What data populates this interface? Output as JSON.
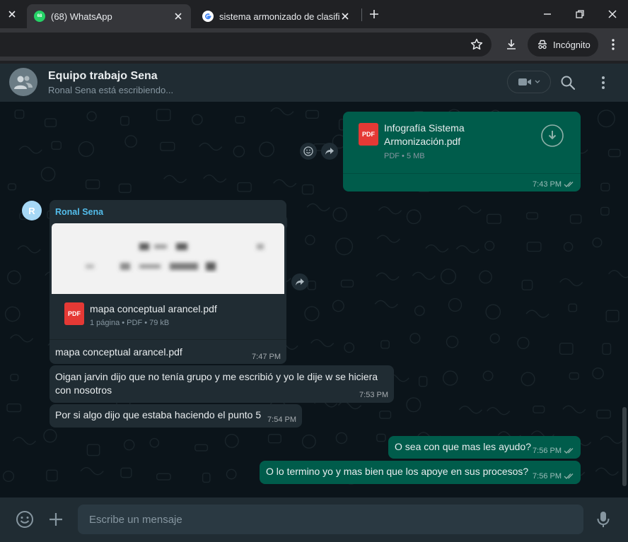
{
  "browser": {
    "tabs": [
      {
        "title": "(68) WhatsApp",
        "badge": "68",
        "active": true
      },
      {
        "title": "sistema armonizado de clasificaci",
        "active": false
      }
    ],
    "incognito_label": "Incógnito"
  },
  "chat": {
    "name": "Equipo trabajo Sena",
    "status": "Ronal Sena está escribiendo..."
  },
  "messages": {
    "m1": {
      "file_name": "Infografía Sistema Armonización.pdf",
      "file_info": "PDF • 5 MB",
      "pdf_label": "PDF",
      "time": "7:43 PM"
    },
    "m2": {
      "avatar_initial": "R",
      "sender": "Ronal Sena",
      "file_name": "mapa conceptual arancel.pdf",
      "file_info": "1 página • PDF • 79 kB",
      "pdf_label": "PDF",
      "caption": "mapa conceptual arancel.pdf",
      "time": "7:47 PM"
    },
    "m3": {
      "text": "Oigan jarvin dijo que no tenía grupo y me escribió y yo le dije w se hiciera con nosotros",
      "time": "7:53 PM"
    },
    "m4": {
      "text": "Por si algo dijo que estaba haciendo el punto 5",
      "time": "7:54 PM"
    },
    "m5": {
      "text": "O sea con que mas les ayudo?",
      "time": "7:56 PM"
    },
    "m6": {
      "text": "O lo termino yo y mas bien que los apoye en sus procesos?",
      "time": "7:56 PM"
    }
  },
  "composer": {
    "placeholder": "Escribe un mensaje"
  },
  "colors": {
    "outgoing": "#005c4b",
    "incoming": "#202c33",
    "sender_name": "#53bdeb",
    "pdf": "#e53935",
    "background": "#0b141a"
  }
}
